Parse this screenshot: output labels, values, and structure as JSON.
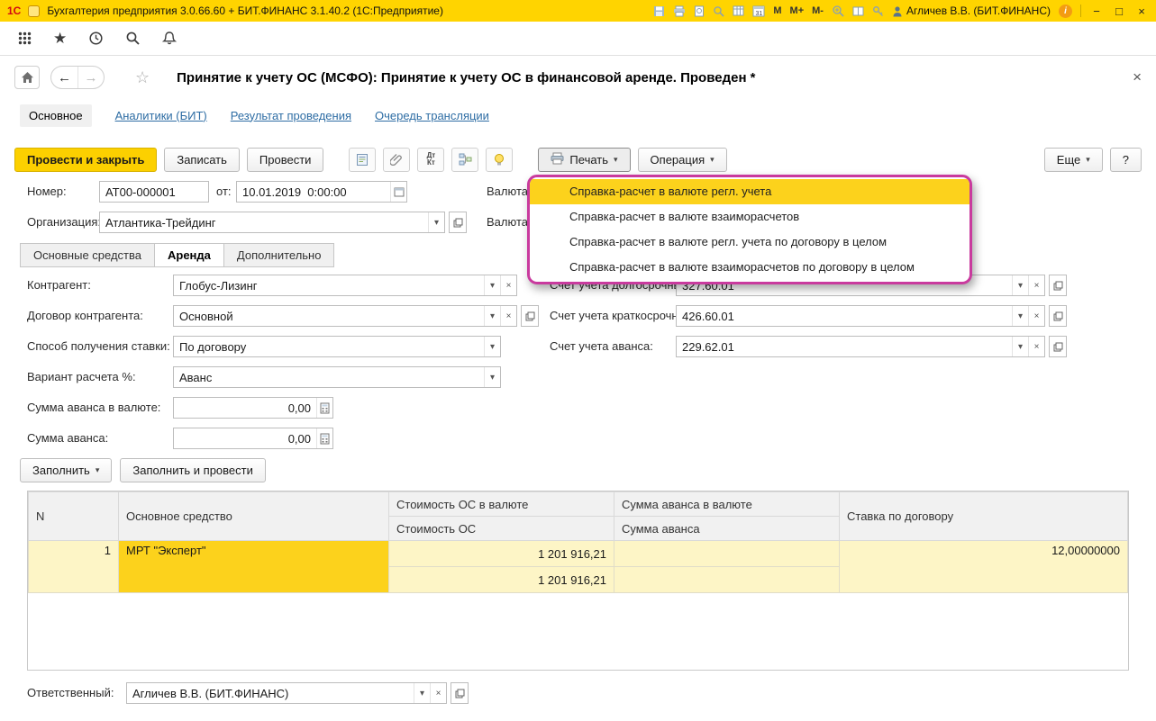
{
  "window": {
    "logo": "1С",
    "title": "Бухгалтерия предприятия 3.0.66.60 + БИТ.ФИНАНС 3.1.40.2 (1С:Предприятие)",
    "memory": [
      "M",
      "M+",
      "M-"
    ],
    "calendar_day": "31",
    "user": "Агличев В.В. (БИТ.ФИНАНС)"
  },
  "header": {
    "title": "Принятие к учету ОС (МСФО): Принятие к учету ОС в финансовой  аренде. Проведен *"
  },
  "tabs": {
    "main": "Основное",
    "links": [
      "Аналитики (БИТ)",
      "Результат проведения",
      "Очередь трансляции"
    ]
  },
  "toolbar": {
    "post_and_close": "Провести и закрыть",
    "write": "Записать",
    "post": "Провести",
    "dt": "Дт",
    "kt": "Кт",
    "print": "Печать",
    "operation": "Операция",
    "more": "Еще",
    "help": "?"
  },
  "print_menu": {
    "items": [
      "Справка-расчет в валюте регл. учета",
      "Справка-расчет в валюте взаиморасчетов",
      "Справка-расчет в валюте регл. учета по договору в целом",
      "Справка-расчет в валюте взаиморасчетов по договору в целом"
    ]
  },
  "form": {
    "number": {
      "label": "Номер:",
      "value": "АТ00-000001"
    },
    "date": {
      "label": "от:",
      "value": "10.01.2019  0:00:00"
    },
    "currency1": {
      "label": "Валюта"
    },
    "currency2": {
      "label": "Валюта"
    },
    "organization": {
      "label": "Организация:",
      "value": "Атлантика-Трейдинг"
    },
    "subtabs": [
      {
        "label": "Основные средства"
      },
      {
        "label": "Аренда"
      },
      {
        "label": "Дополнительно"
      }
    ],
    "contractor": {
      "label": "Контрагент:",
      "value": "Глобус-Лизинг"
    },
    "contract": {
      "label": "Договор контрагента:",
      "value": "Основной"
    },
    "rate_method": {
      "label": "Способ получения ставки:",
      "value": "По договору"
    },
    "calc_variant": {
      "label": "Вариант расчета %:",
      "value": "Аванс"
    },
    "advance_currency": {
      "label": "Сумма аванса в валюте:",
      "value": "0,00"
    },
    "advance": {
      "label": "Сумма аванса:",
      "value": "0,00"
    },
    "account_long": {
      "label": "Счет учета долгосрочный:",
      "value": "327.60.01"
    },
    "account_short": {
      "label": "Счет учета краткосрочный:",
      "value": "426.60.01"
    },
    "account_advance": {
      "label": "Счет учета аванса:",
      "value": "229.62.01"
    },
    "fill": "Заполнить",
    "fill_and_post": "Заполнить и провести",
    "responsible": {
      "label": "Ответственный:",
      "value": "Агличев В.В. (БИТ.ФИНАНС)"
    }
  },
  "grid": {
    "headers": {
      "n": "N",
      "asset": "Основное средство",
      "cost_currency": "Стоимость ОС в валюте",
      "cost": "Стоимость ОС",
      "advance_currency": "Сумма аванса в валюте",
      "advance": "Сумма аванса",
      "rate": "Ставка по договору"
    },
    "rows": [
      {
        "n": "1",
        "asset": "МРТ \"Эксперт\"",
        "cost_currency": "1 201 916,21",
        "cost": "1 201 916,21",
        "advance_currency": "",
        "advance": "",
        "rate": "12,00000000"
      }
    ]
  }
}
